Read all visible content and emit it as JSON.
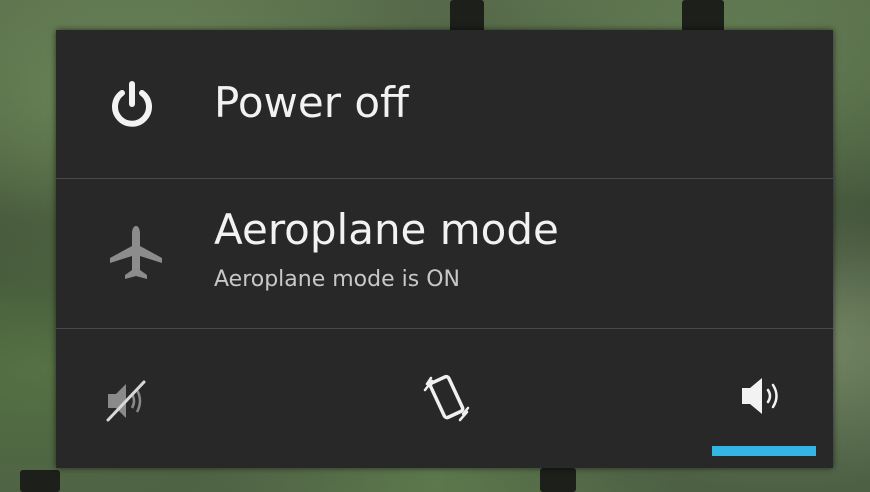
{
  "dialog": {
    "power_off": {
      "label": "Power off",
      "icon": "power-icon"
    },
    "airplane_mode": {
      "label": "Aeroplane mode",
      "status": "Aeroplane mode is ON",
      "icon": "airplane-icon"
    },
    "sound_modes": {
      "options": [
        {
          "icon": "sound-off-icon",
          "selected": false
        },
        {
          "icon": "vibrate-icon",
          "selected": false
        },
        {
          "icon": "sound-on-icon",
          "selected": true
        }
      ],
      "accent_color": "#33b5e5"
    }
  },
  "colors": {
    "dialog_background": "#282828",
    "divider": "#4a4a4a",
    "text_primary": "#f2f2f2",
    "text_secondary": "#c8c8c8"
  }
}
